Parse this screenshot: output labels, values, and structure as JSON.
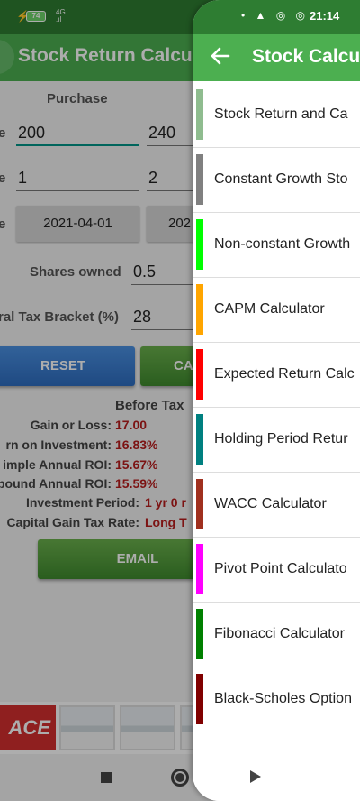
{
  "status_bar": {
    "battery": "74",
    "signal": "4G",
    "time": "21:14"
  },
  "background_app": {
    "title": "Stock Return Calcul",
    "purchase_header": "Purchase",
    "fields": [
      {
        "label": "e",
        "purchase_value": "200",
        "sale_value": "240"
      },
      {
        "label": "e",
        "purchase_value": "1",
        "sale_value": "2"
      },
      {
        "label": "e",
        "purchase_date": "2021-04-01",
        "sale_date": "202"
      }
    ],
    "shares_owned_label": "Shares owned",
    "shares_owned_value": "0.5",
    "tax_bracket_label": "ral Tax Bracket (%)",
    "tax_bracket_value": "28",
    "reset_label": "RESET",
    "calc_label": "CA",
    "before_tax_header": "Before Tax",
    "results": [
      {
        "label": "Gain or Loss:",
        "value": "17.00"
      },
      {
        "label": "rn on Investment:",
        "value": "16.83%"
      },
      {
        "label": "imple Annual ROI:",
        "value": "15.67%"
      },
      {
        "label": "pound Annual ROI:",
        "value": "15.59%"
      },
      {
        "label": "Investment Period:",
        "value": "1 yr  0 r"
      },
      {
        "label": "Capital Gain Tax Rate:",
        "value": "Long T"
      }
    ],
    "email_label": "EMAIL",
    "ad_text": "ACE"
  },
  "drawer": {
    "title": "Stock Calcul",
    "items": [
      {
        "label": "Stock Return and Ca",
        "color": "#8fbc8f"
      },
      {
        "label": "Constant Growth Sto",
        "color": "#808080"
      },
      {
        "label": "Non-constant Growth",
        "color": "#00ff00"
      },
      {
        "label": "CAPM Calculator",
        "color": "#ffa500"
      },
      {
        "label": "Expected Return Calc",
        "color": "#ff0000"
      },
      {
        "label": "Holding Period Retur",
        "color": "#008080"
      },
      {
        "label": "WACC Calculator",
        "color": "#a0301f"
      },
      {
        "label": "Pivot Point Calculato",
        "color": "#ff00ff"
      },
      {
        "label": "Fibonacci Calculator",
        "color": "#008000"
      },
      {
        "label": "Black-Scholes Option",
        "color": "#800000"
      }
    ]
  }
}
